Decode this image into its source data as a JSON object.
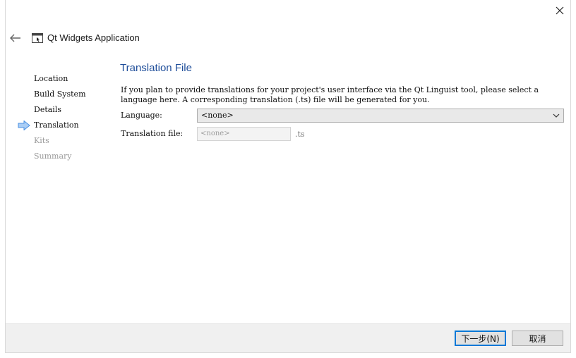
{
  "window": {
    "title": "Qt Widgets Application"
  },
  "steps": [
    {
      "label": "Location",
      "state": "done"
    },
    {
      "label": "Build System",
      "state": "done"
    },
    {
      "label": "Details",
      "state": "done"
    },
    {
      "label": "Translation",
      "state": "current"
    },
    {
      "label": "Kits",
      "state": "pending"
    },
    {
      "label": "Summary",
      "state": "pending"
    }
  ],
  "page": {
    "title": "Translation File",
    "description": "If you plan to provide translations for your project's user interface via the Qt Linguist tool, please select a language here. A corresponding translation (.ts) file will be generated for you.",
    "language_label": "Language:",
    "language_value": "<none>",
    "translation_file_label": "Translation file:",
    "translation_file_value": "<none>",
    "translation_file_suffix": ".ts"
  },
  "buttons": {
    "next": "下一步(N)",
    "cancel": "取消"
  },
  "icons": {
    "close": "close-icon",
    "back": "back-arrow-icon",
    "app": "window-app-icon",
    "current_step": "current-step-arrow-icon",
    "dropdown": "chevron-down-icon"
  },
  "colors": {
    "title_blue": "#1f4e9a",
    "step_arrow": "#4a90e2",
    "disabled_text": "#9a9a9a",
    "default_button_border": "#0078d7"
  }
}
